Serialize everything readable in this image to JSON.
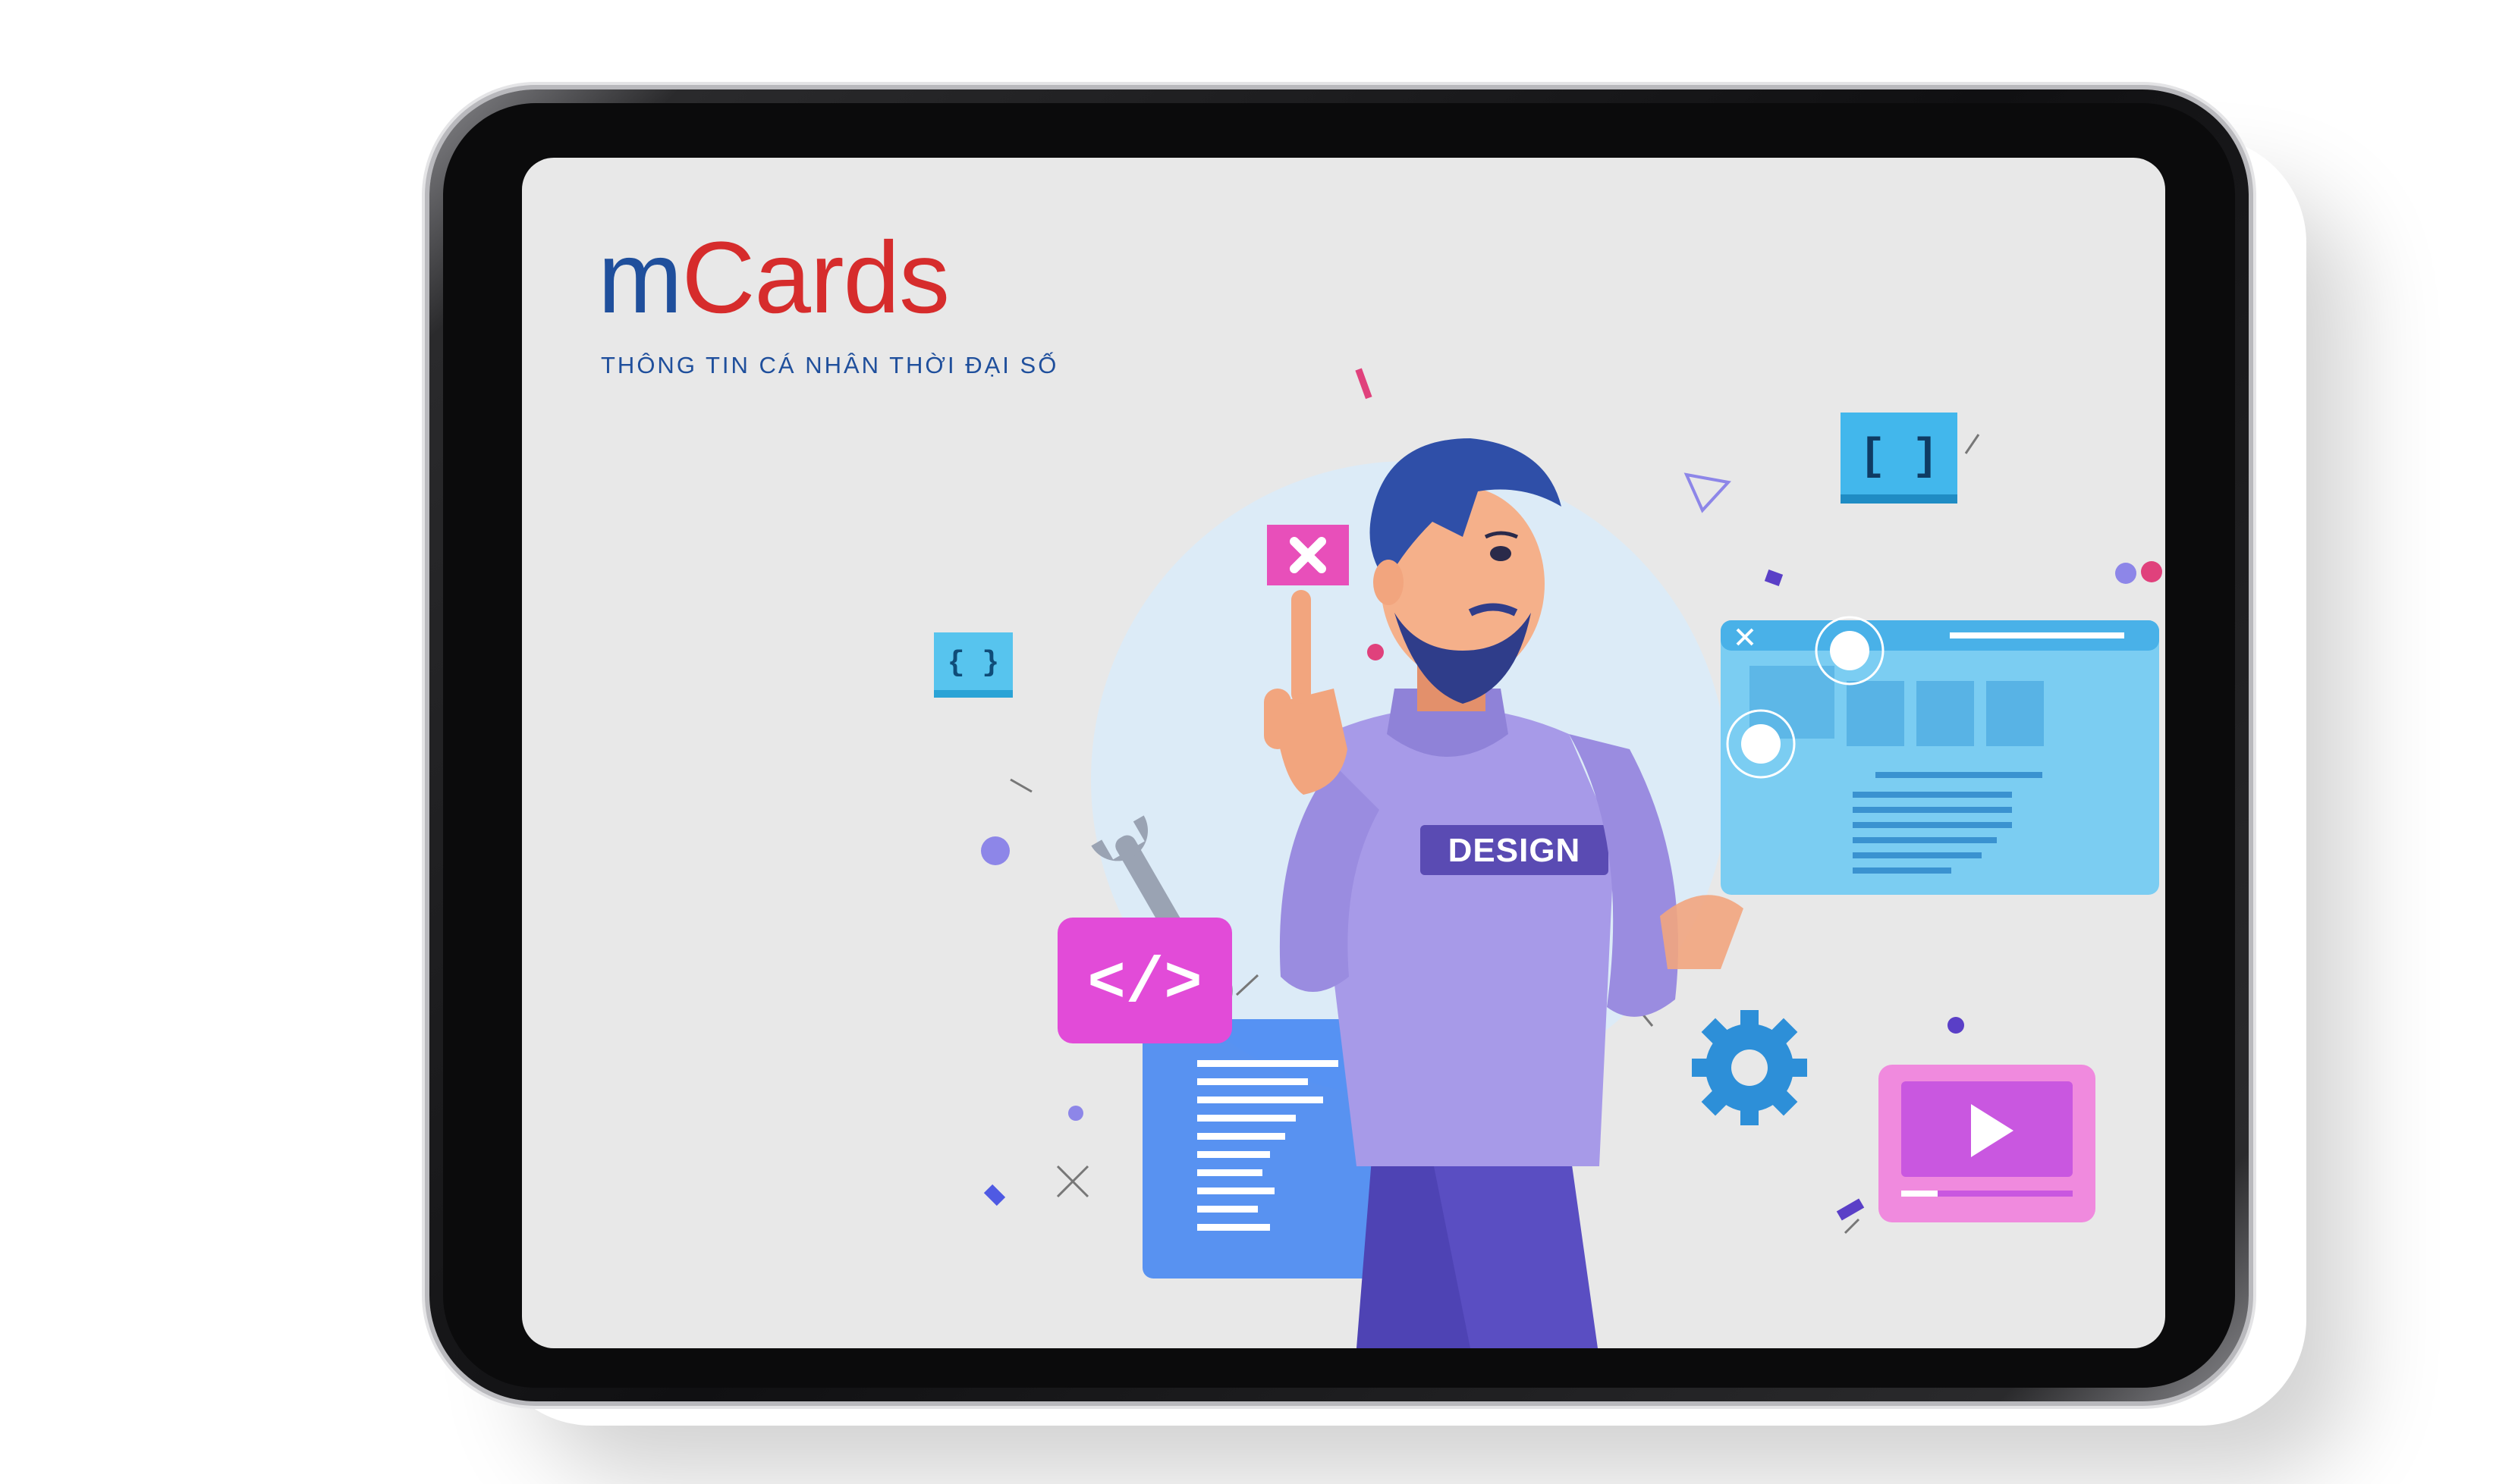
{
  "logo": {
    "part1": "m",
    "part2": "Cards"
  },
  "tagline": "THÔNG TIN CÁ NHÂN THỜI ĐẠI SỐ",
  "illustration": {
    "shirt_text": "DESIGN",
    "brackets_large": "[ ]",
    "brackets_small": "{ }",
    "code_tag": "</>"
  },
  "colors": {
    "brand_blue": "#1f4f9c",
    "brand_red": "#d62c2c",
    "screen_bg": "#e8e8e8",
    "accent_pink": "#e24bd8",
    "accent_purple": "#8d86e8",
    "accent_cyan": "#4fb9e8"
  }
}
